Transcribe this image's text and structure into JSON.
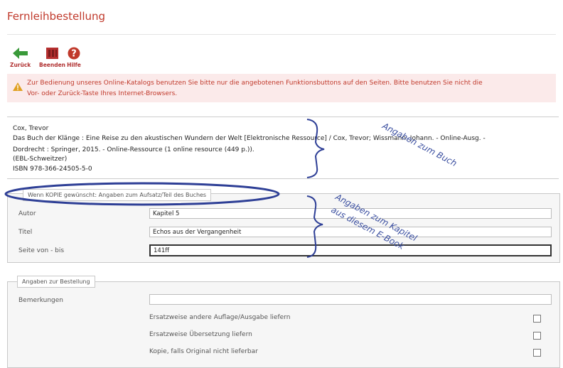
{
  "page": {
    "title": "Fernleihbestellung"
  },
  "toolbar": {
    "back_label": "Zurück",
    "quit_label": "Beenden",
    "help_label": "Hilfe"
  },
  "warning": {
    "line1": "Zur Bedienung unseres Online-Katalogs benutzen Sie bitte nur die angebotenen Funktionsbuttons auf den Seiten. Bitte benutzen Sie nicht die",
    "line2": "Vor- oder Zurück-Taste Ihres Internet-Browsers."
  },
  "book": {
    "author": "Cox, Trevor",
    "title_line1": "Das Buch der Klänge : Eine Reise zu den akustischen Wundern der Welt [Elektronische Ressource] / Cox, Trevor; Wissmann, Johann. - Online-Ausg. -",
    "title_line2": "Dordrecht : Springer, 2015. - Online-Ressource (1 online resource (449 p.)).",
    "series": "(EBL-Schweitzer)",
    "isbn": "ISBN 978-366-24505-5-0"
  },
  "copy_section": {
    "legend": "Wenn KOPIE gewünscht: Angaben zum Aufsatz/Teil des Buches",
    "fields": [
      {
        "label": "Autor",
        "value": "Kapitel 5"
      },
      {
        "label": "Titel",
        "value": "Echos aus der Vergangenheit"
      },
      {
        "label": "Seite von - bis",
        "value": "141ff"
      }
    ]
  },
  "order_section": {
    "legend": "Angaben zur Bestellung",
    "remarks_label": "Bemerkungen",
    "remarks_value": "",
    "options": [
      {
        "label": "Ersatzweise andere Auflage/Ausgabe liefern",
        "checked": false
      },
      {
        "label": "Ersatzweise Übersetzung liefern",
        "checked": false
      },
      {
        "label": "Kopie, falls Original nicht lieferbar",
        "checked": false
      }
    ]
  },
  "annotations": {
    "book_note": "Angaben zum Buch",
    "chapter_line1": "Angaben zum Kapitel",
    "chapter_line2": "aus diesem E-Book",
    "annotation_color": "#2e3f96"
  },
  "icons": {
    "back": "back-arrow-icon",
    "quit": "quit-book-icon",
    "help": "help-icon",
    "warning": "warning-icon"
  },
  "colors": {
    "title": "#c0392b",
    "warning_bg": "#fbeaea",
    "back_green": "#3a9a3a",
    "quit_red": "#c0392b"
  }
}
